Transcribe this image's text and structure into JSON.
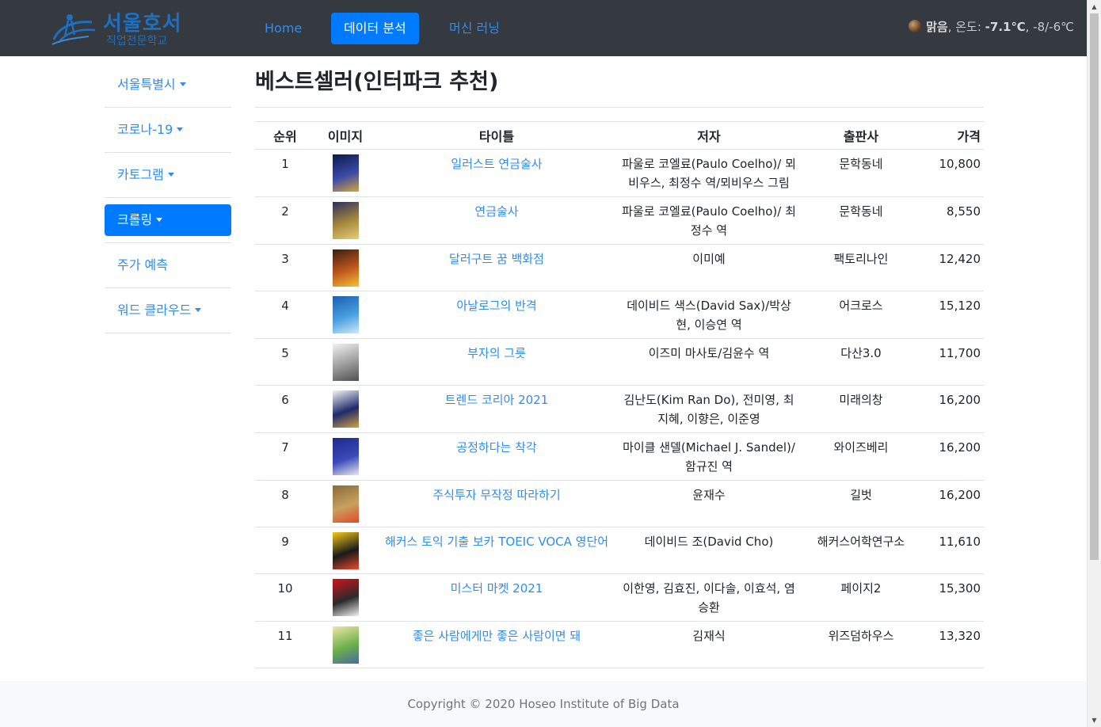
{
  "brand": {
    "line1": "서울호서",
    "line2": "직업전문학교"
  },
  "nav": {
    "items": [
      {
        "label": "Home",
        "active": false
      },
      {
        "label": "데이터 분석",
        "active": true
      },
      {
        "label": "머신 러닝",
        "active": false
      }
    ]
  },
  "weather": {
    "icon": "weather-icon",
    "condition": "맑음",
    "temp_label": ", 온도: ",
    "temp": "-7.1℃",
    "range": ", -8/-6℃"
  },
  "sidebar": {
    "items": [
      {
        "label": "서울특별시",
        "dropdown": true,
        "active": false
      },
      {
        "label": "코로나-19",
        "dropdown": true,
        "active": false
      },
      {
        "label": "카토그램",
        "dropdown": true,
        "active": false
      },
      {
        "label": "크롤링",
        "dropdown": true,
        "active": true
      },
      {
        "label": "주가 예측",
        "dropdown": false,
        "active": false
      },
      {
        "label": "워드 클라우드",
        "dropdown": true,
        "active": false
      }
    ]
  },
  "main": {
    "title": "베스트셀러(인터파크 추천)",
    "columns": [
      "순위",
      "이미지",
      "타이틀",
      "저자",
      "출판사",
      "가격"
    ],
    "rows": [
      {
        "rank": "1",
        "title": "일러스트 연금술사",
        "author": "파울로 코엘료(Paulo Coelho)/ 뫼비우스, 최정수 역/뫼비우스 그림",
        "publisher": "문학동네",
        "price": "10,800",
        "cover": [
          "#0d1a4a",
          "#3a4aa8",
          "#d4a63a"
        ]
      },
      {
        "rank": "2",
        "title": "연금술사",
        "author": "파울로 코엘료(Paulo Coelho)/ 최정수 역",
        "publisher": "문학동네",
        "price": "8,550",
        "cover": [
          "#2a2f5e",
          "#a88a3c",
          "#e6cc7a"
        ]
      },
      {
        "rank": "3",
        "title": "달러구트 꿈 백화점",
        "author": "이미예",
        "publisher": "팩토리나인",
        "price": "12,420",
        "cover": [
          "#3a1e12",
          "#c0581c",
          "#f2c23a"
        ]
      },
      {
        "rank": "4",
        "title": "아날로그의 반격",
        "author": "데이비드 색스(David Sax)/박상현, 이승연 역",
        "publisher": "어크로스",
        "price": "15,120",
        "cover": [
          "#1a5fb0",
          "#4aa0e0",
          "#d0e8f6"
        ]
      },
      {
        "rank": "5",
        "title": "부자의 그릇",
        "author": "이즈미 마사토/김윤수 역",
        "publisher": "다산3.0",
        "price": "11,700",
        "cover": [
          "#f2f2f2",
          "#9a9a9a",
          "#505050"
        ]
      },
      {
        "rank": "6",
        "title": "트렌드 코리아 2021",
        "author": "김난도(Kim Ran Do), 전미영, 최지혜, 이향은, 이준영",
        "publisher": "미래의창",
        "price": "16,200",
        "cover": [
          "#f4f4f4",
          "#1e2a6a",
          "#d0a040"
        ]
      },
      {
        "rank": "7",
        "title": "공정하다는 착각",
        "author": "마이클 샌델(Michael J. Sandel)/함규진 역",
        "publisher": "와이즈베리",
        "price": "16,200",
        "cover": [
          "#1a2a8a",
          "#3a4ab8",
          "#e8e8f0"
        ]
      },
      {
        "rank": "8",
        "title": "주식투자 무작정 따라하기",
        "author": "윤재수",
        "publisher": "길벗",
        "price": "16,200",
        "cover": [
          "#8a6a3a",
          "#c8a060",
          "#e04a2a"
        ]
      },
      {
        "rank": "9",
        "title": "해커스 토익 기출 보카 TOEIC VOCA 영단어",
        "author": "데이비드 조(David Cho)",
        "publisher": "해커스어학연구소",
        "price": "11,610",
        "cover": [
          "#f4c81a",
          "#1a1a1a",
          "#e84a2a"
        ]
      },
      {
        "rank": "10",
        "title": "미스터 마켓 2021",
        "author": "이한영, 김효진, 이다솔, 이효석, 염승환",
        "publisher": "페이지2",
        "price": "15,300",
        "cover": [
          "#d0141e",
          "#2a2a2a",
          "#f2f2f2"
        ]
      },
      {
        "rank": "11",
        "title": "좋은 사람에게만 좋은 사람이면 돼",
        "author": "김재식",
        "publisher": "위즈덤하우스",
        "price": "13,320",
        "cover": [
          "#f0e4a8",
          "#6ab04a",
          "#4a6aa0"
        ]
      }
    ]
  },
  "footer": {
    "text": "Copyright © 2020 Hoseo Institute of Big Data"
  }
}
